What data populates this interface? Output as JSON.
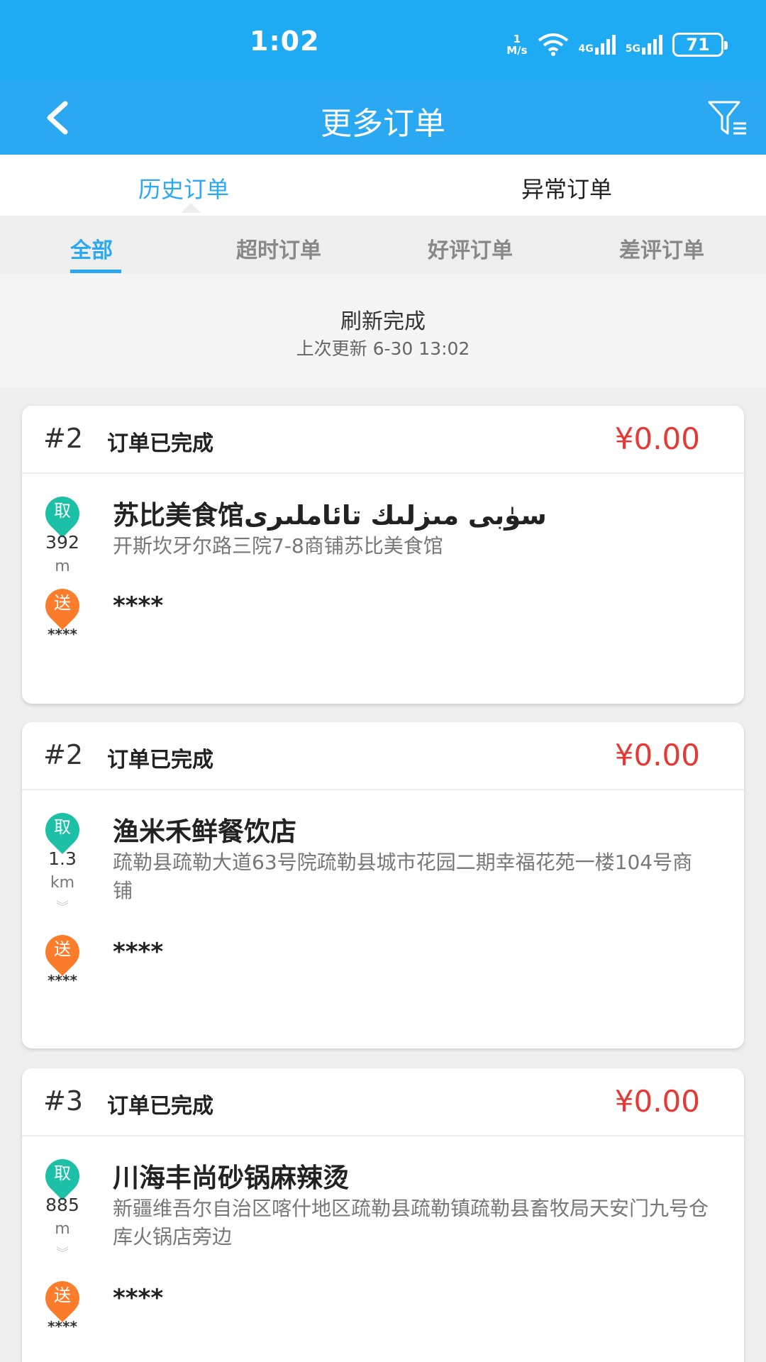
{
  "status_bar": {
    "time": "1:02",
    "speed_value": "1",
    "speed_unit": "M/s",
    "net1": "4G",
    "net2": "5G",
    "battery": "71"
  },
  "header": {
    "title": "更多订单"
  },
  "main_tabs": [
    {
      "label": "历史订单"
    },
    {
      "label": "异常订单"
    }
  ],
  "sub_tabs": [
    {
      "label": "全部"
    },
    {
      "label": "超时订单"
    },
    {
      "label": "好评订单"
    },
    {
      "label": "差评订单"
    }
  ],
  "refresh": {
    "title": "刷新完成",
    "subtitle": "上次更新 6-30 13:02"
  },
  "orders": [
    {
      "number": "#2",
      "status": "订单已完成",
      "price": "¥0.00",
      "pickup_badge": "取",
      "distance": "392",
      "distance_unit": "m",
      "shop_name": "苏比美食馆سۈبى مىزلىك تائاملىرى",
      "shop_address": "开斯坎牙尔路三院7-8商铺苏比美食馆",
      "deliver_badge": "送",
      "deliver_small": "****",
      "customer": "****"
    },
    {
      "number": "#2",
      "status": "订单已完成",
      "price": "¥0.00",
      "pickup_badge": "取",
      "distance": "1.3",
      "distance_unit": "km",
      "shop_name": "渔米禾鲜餐饮店",
      "shop_address": "疏勒县疏勒大道63号院疏勒县城市花园二期幸福花苑一楼104号商铺",
      "deliver_badge": "送",
      "deliver_small": "****",
      "customer": "****"
    },
    {
      "number": "#3",
      "status": "订单已完成",
      "price": "¥0.00",
      "pickup_badge": "取",
      "distance": "885",
      "distance_unit": "m",
      "shop_name": "川海丰尚砂锅麻辣烫",
      "shop_address": "新疆维吾尔自治区喀什地区疏勒县疏勒镇疏勒县畜牧局天安门九号仓库火锅店旁边",
      "deliver_badge": "送",
      "deliver_small": "****",
      "customer": "****"
    }
  ],
  "colors": {
    "primary": "#2aa9f2",
    "price": "#e53935",
    "pickup": "#1cc0a6",
    "deliver": "#fb7d2b"
  }
}
